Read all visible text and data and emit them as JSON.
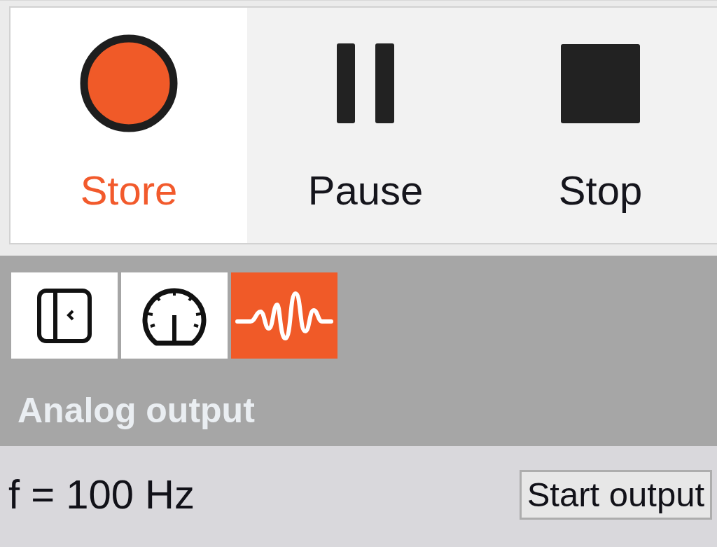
{
  "toolbar": {
    "buttons": [
      {
        "kind": "record",
        "label": "Store",
        "selected": true
      },
      {
        "kind": "pause",
        "label": "Pause",
        "selected": false
      },
      {
        "kind": "stop",
        "label": "Stop",
        "selected": false
      }
    ]
  },
  "view_tabs": [
    {
      "kind": "sidebar",
      "selected": false
    },
    {
      "kind": "gauge",
      "selected": false
    },
    {
      "kind": "waveform",
      "selected": true
    }
  ],
  "panel": {
    "title": "Analog output",
    "frequency": "f = 100 Hz",
    "start_button": "Start output"
  }
}
